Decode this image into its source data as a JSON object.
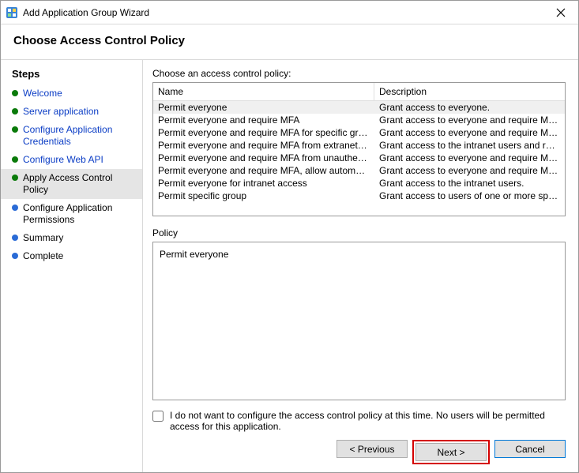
{
  "window": {
    "title": "Add Application Group Wizard",
    "page_title": "Choose Access Control Policy"
  },
  "sidebar": {
    "heading": "Steps",
    "items": [
      {
        "label": "Welcome",
        "state": "completed"
      },
      {
        "label": "Server application",
        "state": "completed"
      },
      {
        "label": "Configure Application Credentials",
        "state": "completed"
      },
      {
        "label": "Configure Web API",
        "state": "completed"
      },
      {
        "label": "Apply Access Control Policy",
        "state": "current"
      },
      {
        "label": "Configure Application Permissions",
        "state": "after"
      },
      {
        "label": "Summary",
        "state": "after"
      },
      {
        "label": "Complete",
        "state": "after"
      }
    ]
  },
  "main": {
    "choose_label": "Choose an access control policy:",
    "columns": {
      "name": "Name",
      "description": "Description"
    },
    "policies": [
      {
        "name": "Permit everyone",
        "desc": "Grant access to everyone.",
        "selected": true
      },
      {
        "name": "Permit everyone and require MFA",
        "desc": "Grant access to everyone and require MFA f..."
      },
      {
        "name": "Permit everyone and require MFA for specific group",
        "desc": "Grant access to everyone and require MFA f..."
      },
      {
        "name": "Permit everyone and require MFA from extranet access",
        "desc": "Grant access to the intranet users and requir..."
      },
      {
        "name": "Permit everyone and require MFA from unauthenticated ...",
        "desc": "Grant access to everyone and require MFA f..."
      },
      {
        "name": "Permit everyone and require MFA, allow automatic devi...",
        "desc": "Grant access to everyone and require MFA f..."
      },
      {
        "name": "Permit everyone for intranet access",
        "desc": "Grant access to the intranet users."
      },
      {
        "name": "Permit specific group",
        "desc": "Grant access to users of one or more specifi..."
      }
    ],
    "policy_label": "Policy",
    "policy_text": "Permit everyone",
    "opt_out_label": "I do not want to configure the access control policy at this time.  No users will be permitted access for this application.",
    "buttons": {
      "previous": "< Previous",
      "next": "Next >",
      "cancel": "Cancel"
    }
  }
}
